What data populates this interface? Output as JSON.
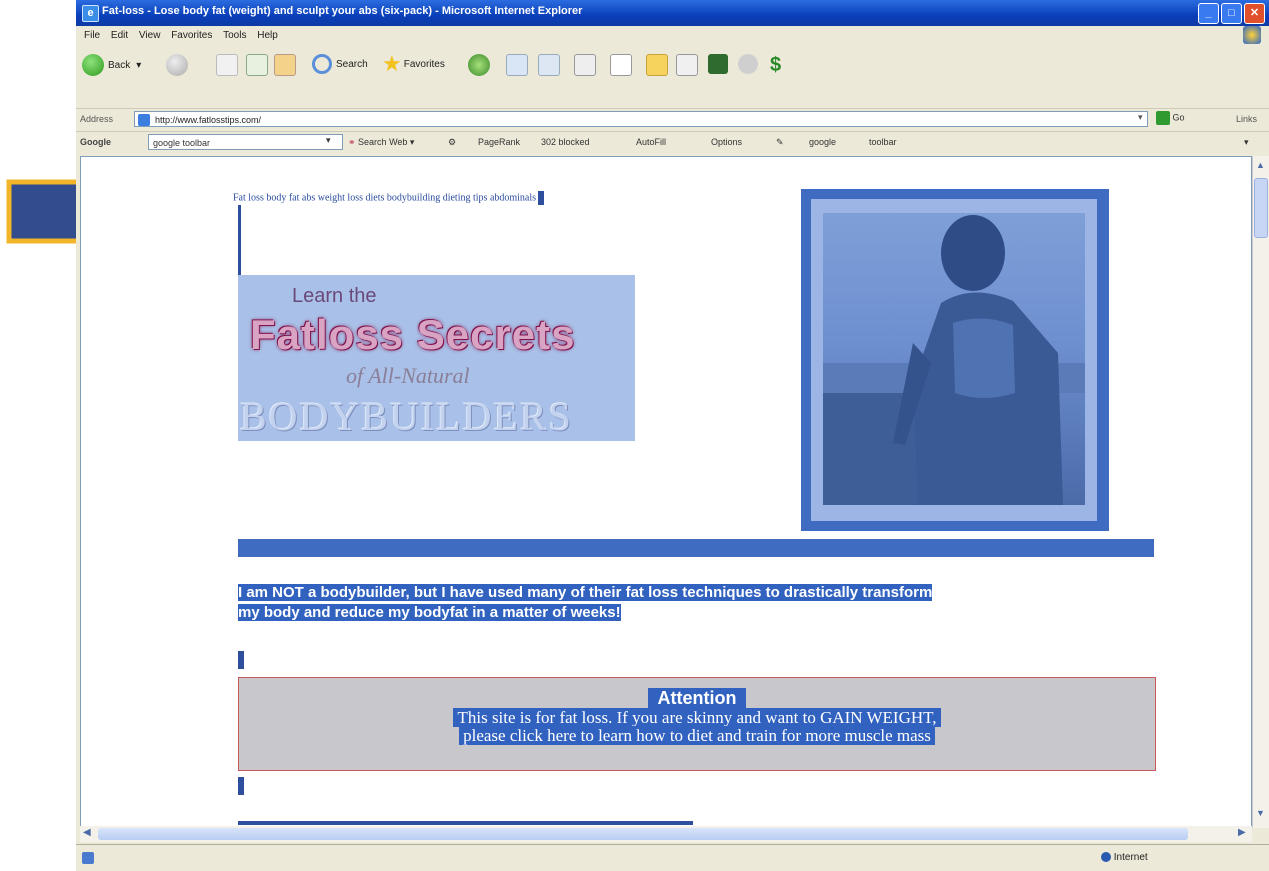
{
  "window": {
    "title": "Fat-loss - Lose body fat (weight) and sculpt your abs (six-pack) - Microsoft Internet Explorer"
  },
  "menu": [
    "File",
    "Edit",
    "View",
    "Favorites",
    "Tools",
    "Help"
  ],
  "toolbar": {
    "back_label": "Back",
    "search_label": "Search",
    "favorites_label": "Favorites"
  },
  "address": {
    "label": "Address",
    "url": "http://www.fatlosstips.com/",
    "go_label": "Go",
    "links_label": "Links"
  },
  "google_toolbar": {
    "label": "Google",
    "combo_value": "google toolbar",
    "search_web": "Search Web",
    "pagerank": "PageRank",
    "popups_blocked": "302 blocked",
    "autofill": "AutoFill",
    "options": "Options",
    "word1": "google",
    "word2": "toolbar"
  },
  "page": {
    "keywords": "Fat loss body fat abs weight loss diets bodybuilding dieting tips abdominals",
    "banner": {
      "learn": "Learn the",
      "headline": "Fatloss Secrets",
      "sub": "of All-Natural",
      "bottom": "BODYBUILDERS"
    },
    "intro_line1": "I am NOT a bodybuilder, but I have used many of their fat loss techniques to drastically transform",
    "intro_line2": "my body and reduce my bodyfat in a matter of weeks!",
    "attention": {
      "heading": "Attention",
      "line1": "This site is for fat loss. If you are skinny and want to GAIN WEIGHT,",
      "line2": "please click here to learn how to diet and train for more muscle mass"
    }
  },
  "status": {
    "zone": "Internet"
  },
  "colors": {
    "accent_blue": "#3f6cc0",
    "arrow_fill": "#324c8e",
    "arrow_outline": "#f2b52a"
  }
}
